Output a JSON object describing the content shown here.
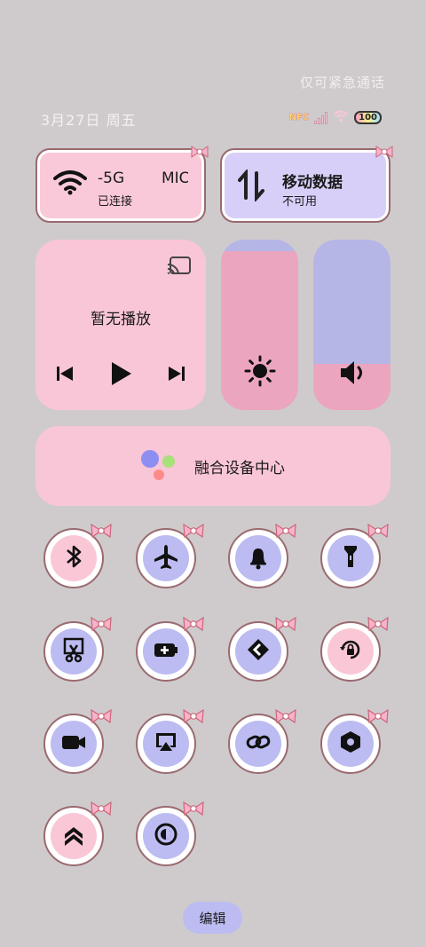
{
  "status": {
    "emergency_text": "仅可紧急通话",
    "date_text": "3月27日 周五",
    "nfc_label": "NFC",
    "battery_label": "100"
  },
  "tiles": {
    "wifi": {
      "name": "-5G",
      "name_extra": "MIC",
      "status": "已连接"
    },
    "mobile_data": {
      "title": "移动数据",
      "status": "不可用"
    }
  },
  "media": {
    "now_playing": "暂无播放"
  },
  "sliders": {
    "brightness_level": 0.93,
    "volume_level": 0.27
  },
  "fusion": {
    "label": "融合设备中心"
  },
  "edit_label": "编辑",
  "colors": {
    "pink": "#fac7d7",
    "lavender": "#bcbcf2",
    "slider_pink": "#eca5bf",
    "slider_lav": "#b6b6e6"
  },
  "toggles": [
    {
      "icon": "bluetooth-icon",
      "style": "pink"
    },
    {
      "icon": "airplane-icon",
      "style": "lavender"
    },
    {
      "icon": "bell-icon",
      "style": "lavender"
    },
    {
      "icon": "flashlight-icon",
      "style": "lavender"
    },
    {
      "icon": "screenshot-icon",
      "style": "lavender"
    },
    {
      "icon": "battery-saver-icon",
      "style": "lavender"
    },
    {
      "icon": "nearby-share-icon",
      "style": "lavender"
    },
    {
      "icon": "rotation-lock-icon",
      "style": "pink"
    },
    {
      "icon": "screen-record-icon",
      "style": "lavender"
    },
    {
      "icon": "screen-cast-icon",
      "style": "lavender"
    },
    {
      "icon": "link-icon",
      "style": "lavender"
    },
    {
      "icon": "hotspot-icon",
      "style": "lavender"
    },
    {
      "icon": "performance-icon",
      "style": "pink"
    },
    {
      "icon": "dark-mode-icon",
      "style": "lavender"
    }
  ]
}
